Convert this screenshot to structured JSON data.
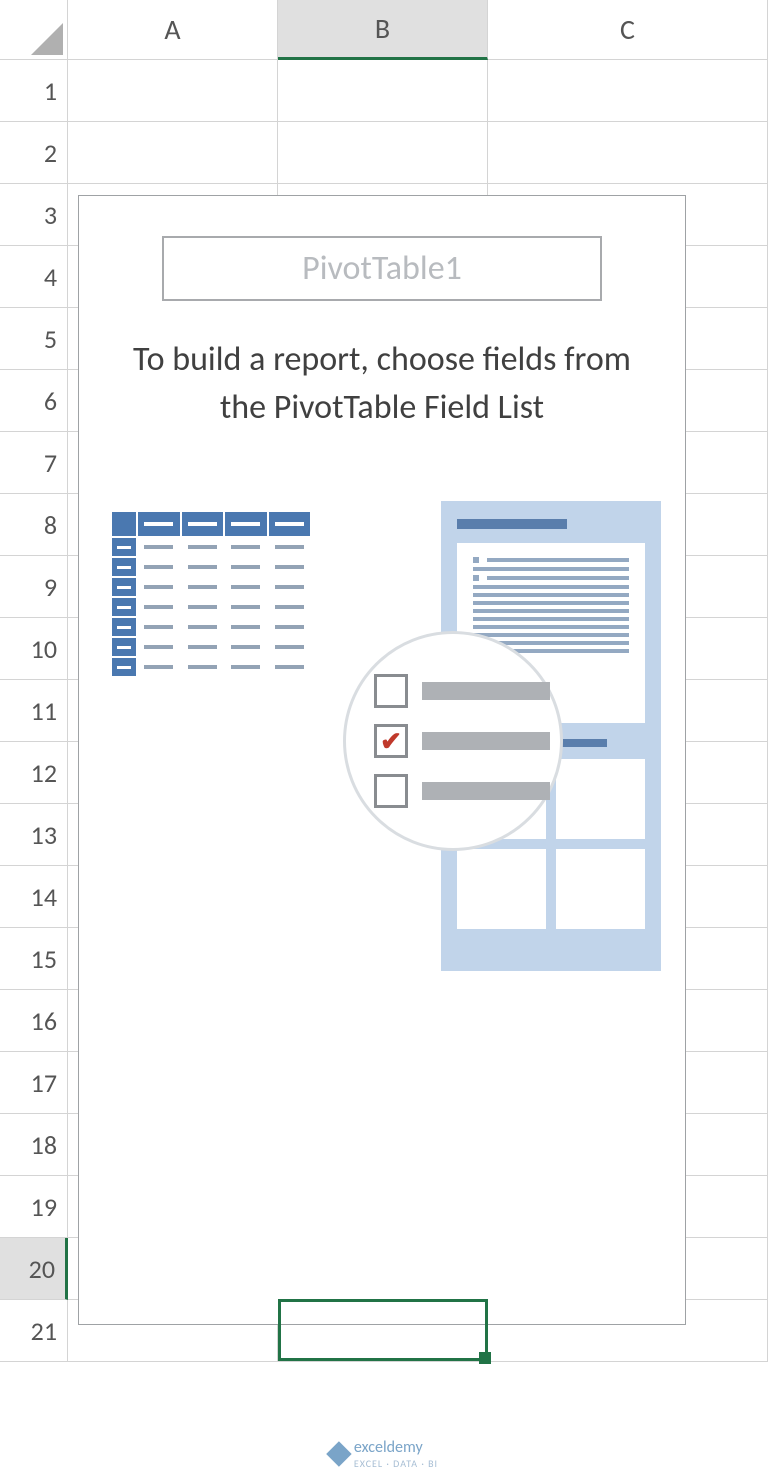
{
  "columns": [
    "A",
    "B",
    "C"
  ],
  "rows": [
    "1",
    "2",
    "3",
    "4",
    "5",
    "6",
    "7",
    "8",
    "9",
    "10",
    "11",
    "12",
    "13",
    "14",
    "15",
    "16",
    "17",
    "18",
    "19",
    "20",
    "21"
  ],
  "selected_column": "B",
  "selected_row": "20",
  "pivot": {
    "title": "PivotTable1",
    "instruction": "To build a report, choose fields from the PivotTable Field List"
  },
  "watermark": {
    "name": "exceldemy",
    "tagline": "EXCEL · DATA · BI"
  }
}
